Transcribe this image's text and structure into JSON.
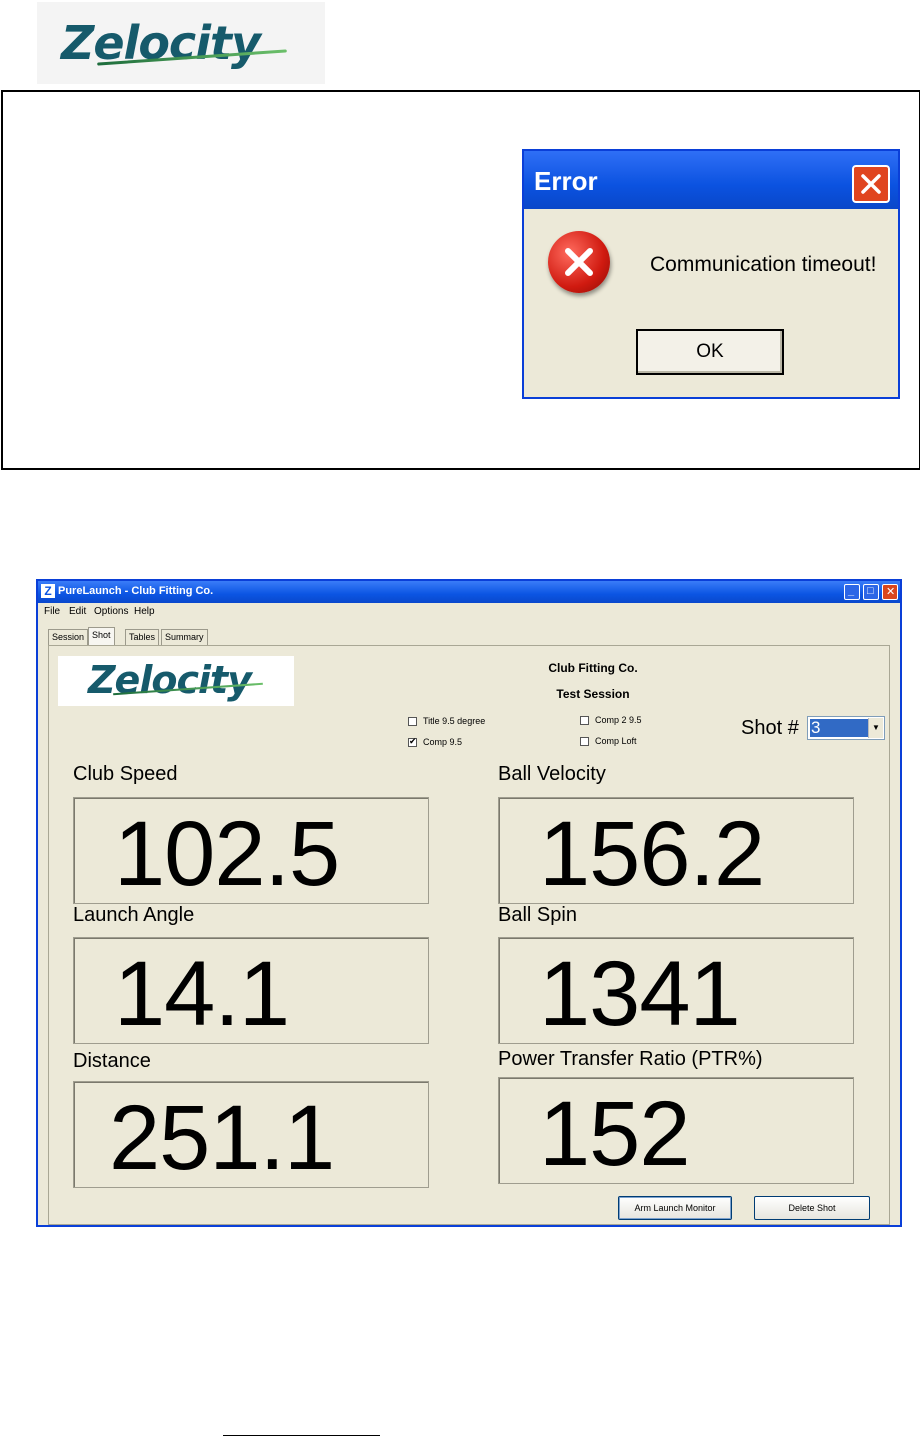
{
  "header": {
    "logo_text": "Zelocity"
  },
  "error_dialog": {
    "title": "Error",
    "message": "Communication timeout!",
    "ok_label": "OK"
  },
  "app": {
    "window_title": "PureLaunch - Club Fitting Co.",
    "menu": [
      "File",
      "Edit",
      "Options",
      "Help"
    ],
    "tabs": [
      "Session",
      "Shot",
      "Tables",
      "Summary"
    ],
    "active_tab": "Shot",
    "logo_text": "Zelocity",
    "company": "Club Fitting Co.",
    "session": "Test Session",
    "checkboxes": [
      {
        "label": "Title 9.5 degree",
        "checked": false
      },
      {
        "label": "Comp 9.5",
        "checked": true
      },
      {
        "label": "Comp 2 9.5",
        "checked": false
      },
      {
        "label": "Comp Loft",
        "checked": false
      }
    ],
    "shot_label": "Shot #",
    "shot_value": "3",
    "metrics": [
      {
        "label": "Club Speed",
        "value": "102.5"
      },
      {
        "label": "Ball Velocity",
        "value": "156.2"
      },
      {
        "label": "Launch Angle",
        "value": "14.1"
      },
      {
        "label": "Ball Spin",
        "value": "1341"
      },
      {
        "label": "Distance",
        "value": "251.1"
      },
      {
        "label": "Power Transfer Ratio (PTR%)",
        "value": "152"
      }
    ],
    "buttons": {
      "arm": "Arm Launch Monitor",
      "delete": "Delete Shot"
    }
  }
}
